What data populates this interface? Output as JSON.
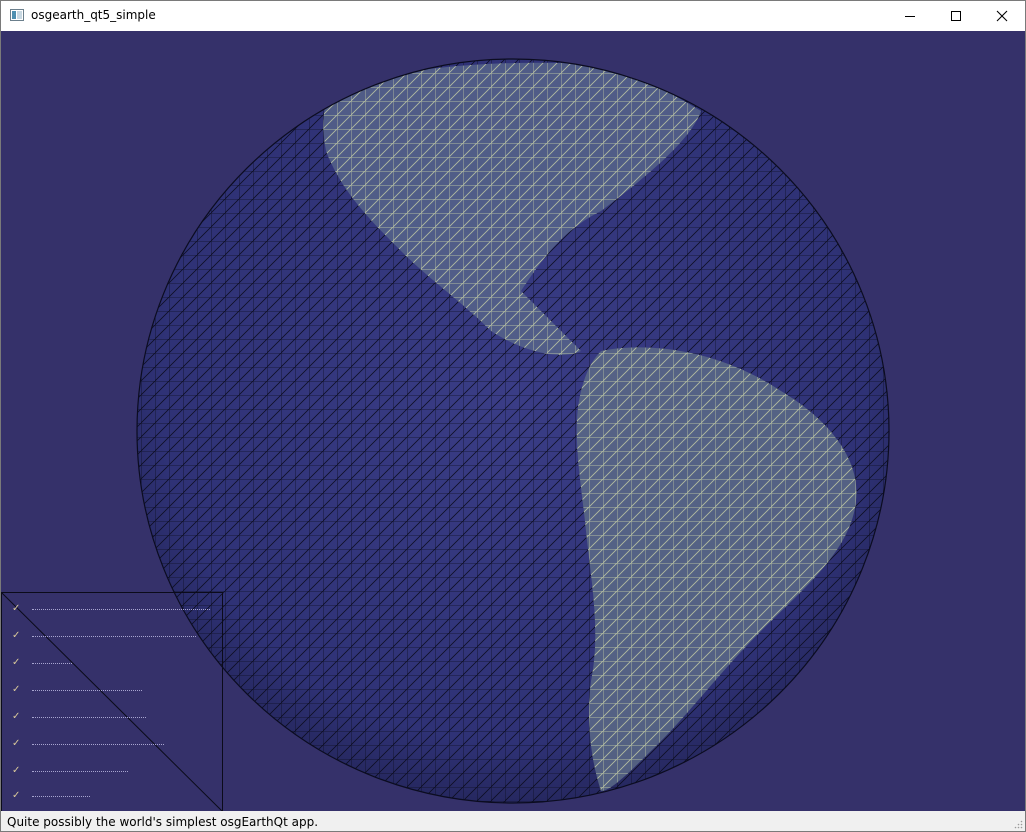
{
  "window": {
    "title": "osgearth_qt5_simple",
    "icon": "app-window-icon",
    "controls": {
      "minimize_icon": "minimize-icon",
      "maximize_icon": "maximize-icon",
      "close_icon": "close-icon"
    }
  },
  "viewport": {
    "background_color": "#35316a",
    "globe_wire_color": "#0a0b1c",
    "land_wire_color": "#cfd9a8"
  },
  "layer_panel": {
    "items": [
      {
        "label": "",
        "checked": true
      },
      {
        "label": "",
        "checked": true
      },
      {
        "label": "",
        "checked": true
      },
      {
        "label": "",
        "checked": true
      },
      {
        "label": "",
        "checked": true
      },
      {
        "label": "",
        "checked": true
      },
      {
        "label": "",
        "checked": true
      },
      {
        "label": "",
        "checked": true
      }
    ]
  },
  "status_bar": {
    "text": "Quite possibly the world's simplest osgEarthQt app.",
    "grip_icon": "size-grip-icon"
  }
}
